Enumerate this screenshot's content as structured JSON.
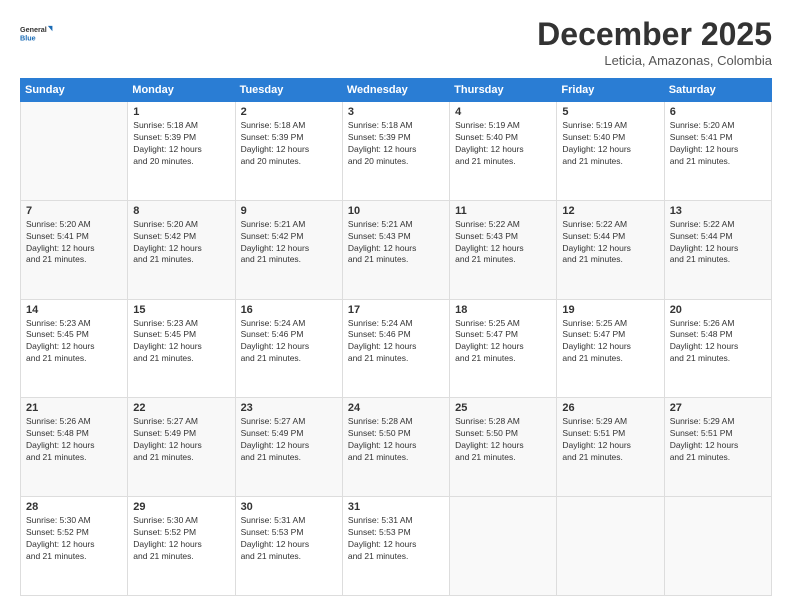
{
  "logo": {
    "line1": "General",
    "line2": "Blue"
  },
  "header": {
    "month": "December 2025",
    "location": "Leticia, Amazonas, Colombia"
  },
  "weekdays": [
    "Sunday",
    "Monday",
    "Tuesday",
    "Wednesday",
    "Thursday",
    "Friday",
    "Saturday"
  ],
  "weeks": [
    [
      {
        "day": "",
        "info": ""
      },
      {
        "day": "1",
        "info": "Sunrise: 5:18 AM\nSunset: 5:39 PM\nDaylight: 12 hours\nand 20 minutes."
      },
      {
        "day": "2",
        "info": "Sunrise: 5:18 AM\nSunset: 5:39 PM\nDaylight: 12 hours\nand 20 minutes."
      },
      {
        "day": "3",
        "info": "Sunrise: 5:18 AM\nSunset: 5:39 PM\nDaylight: 12 hours\nand 20 minutes."
      },
      {
        "day": "4",
        "info": "Sunrise: 5:19 AM\nSunset: 5:40 PM\nDaylight: 12 hours\nand 21 minutes."
      },
      {
        "day": "5",
        "info": "Sunrise: 5:19 AM\nSunset: 5:40 PM\nDaylight: 12 hours\nand 21 minutes."
      },
      {
        "day": "6",
        "info": "Sunrise: 5:20 AM\nSunset: 5:41 PM\nDaylight: 12 hours\nand 21 minutes."
      }
    ],
    [
      {
        "day": "7",
        "info": "Sunrise: 5:20 AM\nSunset: 5:41 PM\nDaylight: 12 hours\nand 21 minutes."
      },
      {
        "day": "8",
        "info": "Sunrise: 5:20 AM\nSunset: 5:42 PM\nDaylight: 12 hours\nand 21 minutes."
      },
      {
        "day": "9",
        "info": "Sunrise: 5:21 AM\nSunset: 5:42 PM\nDaylight: 12 hours\nand 21 minutes."
      },
      {
        "day": "10",
        "info": "Sunrise: 5:21 AM\nSunset: 5:43 PM\nDaylight: 12 hours\nand 21 minutes."
      },
      {
        "day": "11",
        "info": "Sunrise: 5:22 AM\nSunset: 5:43 PM\nDaylight: 12 hours\nand 21 minutes."
      },
      {
        "day": "12",
        "info": "Sunrise: 5:22 AM\nSunset: 5:44 PM\nDaylight: 12 hours\nand 21 minutes."
      },
      {
        "day": "13",
        "info": "Sunrise: 5:22 AM\nSunset: 5:44 PM\nDaylight: 12 hours\nand 21 minutes."
      }
    ],
    [
      {
        "day": "14",
        "info": "Sunrise: 5:23 AM\nSunset: 5:45 PM\nDaylight: 12 hours\nand 21 minutes."
      },
      {
        "day": "15",
        "info": "Sunrise: 5:23 AM\nSunset: 5:45 PM\nDaylight: 12 hours\nand 21 minutes."
      },
      {
        "day": "16",
        "info": "Sunrise: 5:24 AM\nSunset: 5:46 PM\nDaylight: 12 hours\nand 21 minutes."
      },
      {
        "day": "17",
        "info": "Sunrise: 5:24 AM\nSunset: 5:46 PM\nDaylight: 12 hours\nand 21 minutes."
      },
      {
        "day": "18",
        "info": "Sunrise: 5:25 AM\nSunset: 5:47 PM\nDaylight: 12 hours\nand 21 minutes."
      },
      {
        "day": "19",
        "info": "Sunrise: 5:25 AM\nSunset: 5:47 PM\nDaylight: 12 hours\nand 21 minutes."
      },
      {
        "day": "20",
        "info": "Sunrise: 5:26 AM\nSunset: 5:48 PM\nDaylight: 12 hours\nand 21 minutes."
      }
    ],
    [
      {
        "day": "21",
        "info": "Sunrise: 5:26 AM\nSunset: 5:48 PM\nDaylight: 12 hours\nand 21 minutes."
      },
      {
        "day": "22",
        "info": "Sunrise: 5:27 AM\nSunset: 5:49 PM\nDaylight: 12 hours\nand 21 minutes."
      },
      {
        "day": "23",
        "info": "Sunrise: 5:27 AM\nSunset: 5:49 PM\nDaylight: 12 hours\nand 21 minutes."
      },
      {
        "day": "24",
        "info": "Sunrise: 5:28 AM\nSunset: 5:50 PM\nDaylight: 12 hours\nand 21 minutes."
      },
      {
        "day": "25",
        "info": "Sunrise: 5:28 AM\nSunset: 5:50 PM\nDaylight: 12 hours\nand 21 minutes."
      },
      {
        "day": "26",
        "info": "Sunrise: 5:29 AM\nSunset: 5:51 PM\nDaylight: 12 hours\nand 21 minutes."
      },
      {
        "day": "27",
        "info": "Sunrise: 5:29 AM\nSunset: 5:51 PM\nDaylight: 12 hours\nand 21 minutes."
      }
    ],
    [
      {
        "day": "28",
        "info": "Sunrise: 5:30 AM\nSunset: 5:52 PM\nDaylight: 12 hours\nand 21 minutes."
      },
      {
        "day": "29",
        "info": "Sunrise: 5:30 AM\nSunset: 5:52 PM\nDaylight: 12 hours\nand 21 minutes."
      },
      {
        "day": "30",
        "info": "Sunrise: 5:31 AM\nSunset: 5:53 PM\nDaylight: 12 hours\nand 21 minutes."
      },
      {
        "day": "31",
        "info": "Sunrise: 5:31 AM\nSunset: 5:53 PM\nDaylight: 12 hours\nand 21 minutes."
      },
      {
        "day": "",
        "info": ""
      },
      {
        "day": "",
        "info": ""
      },
      {
        "day": "",
        "info": ""
      }
    ]
  ]
}
